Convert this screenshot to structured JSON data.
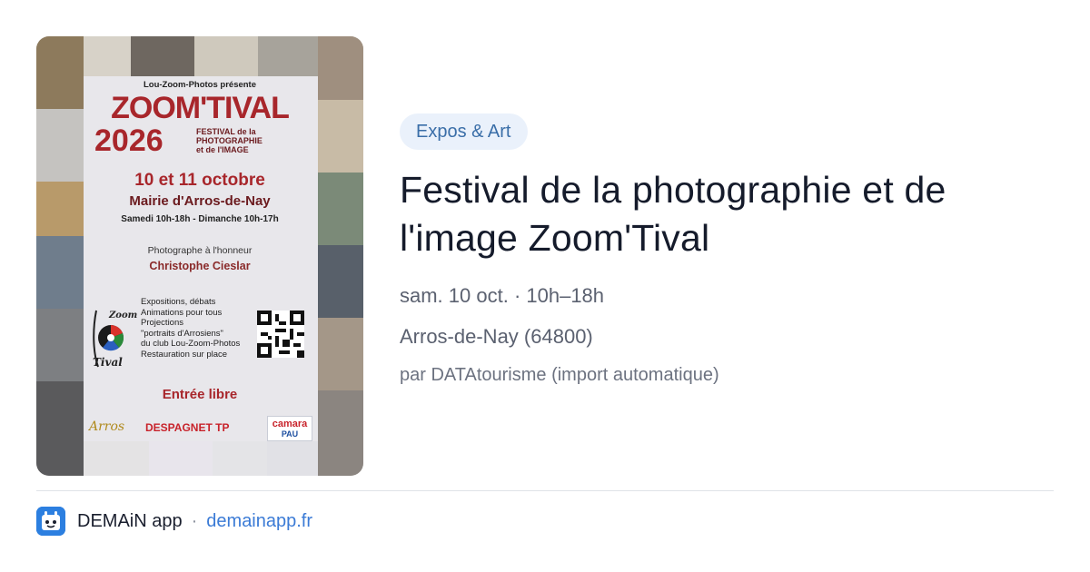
{
  "poster": {
    "presents": "Lou-Zoom-Photos présente",
    "title": "ZOOM'TIVAL",
    "year": "2026",
    "subtitle_1": "FESTIVAL de la",
    "subtitle_2": "PHOTOGRAPHIE",
    "subtitle_3": "et de l'IMAGE",
    "dates": "10 et 11 octobre",
    "place": "Mairie d'Arros-de-Nay",
    "hours": "Samedi 10h-18h - Dimanche 10h-17h",
    "honor_label": "Photographe à l'honneur",
    "honor_name": "Christophe Cieslar",
    "list": "Expositions, débats\nAnimations pour tous\nProjections\n\"portraits d'Arrosiens\"\ndu club Lou-Zoom-Photos\nRestauration sur place",
    "logo_top": "Zoom",
    "logo_bottom": "Tival",
    "entry": "Entrée libre",
    "sponsor_1": "Arros",
    "sponsor_2": "DESPAGNET TP",
    "sponsor_3a": "camara",
    "sponsor_3b": "PAU"
  },
  "category": "Expos & Art",
  "title": "Festival de la photographie et de l'image Zoom'Tival",
  "date_time": "sam. 10 oct. · 10h–18h",
  "location": "Arros-de-Nay (64800)",
  "source": "par DATAtourisme (import automatique)",
  "footer": {
    "app_name": "DEMAiN app",
    "separator": "·",
    "link": "demainapp.fr"
  },
  "colors": {
    "chip_bg": "#eaf1fb",
    "chip_text": "#3a6ea8",
    "link": "#3b7bd6",
    "app_icon": "#2c7fe0",
    "poster_red": "#a8262b"
  },
  "icons": {
    "app_icon": "demain-app-icon"
  }
}
